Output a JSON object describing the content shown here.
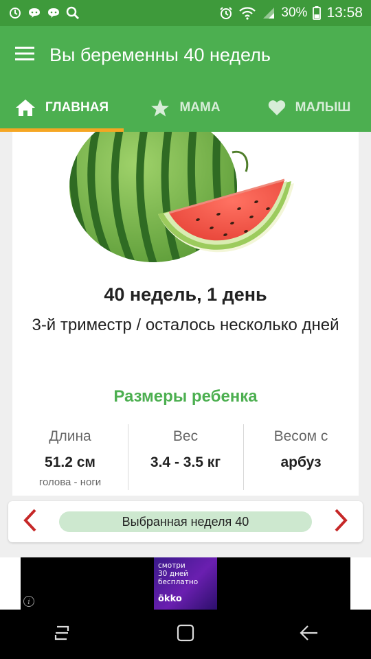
{
  "status_bar": {
    "battery_percent": "30%",
    "time": "13:58",
    "left_icons": [
      "sync-icon",
      "chat-icon",
      "chat-icon",
      "search-icon"
    ],
    "right_icons": [
      "alarm-icon",
      "wifi-icon",
      "signal-icon",
      "battery-icon"
    ]
  },
  "app_bar": {
    "title": "Вы беременны 40 недель"
  },
  "tabs": [
    {
      "label": "ГЛАВНАЯ",
      "icon": "home-icon",
      "active": true
    },
    {
      "label": "МАМА",
      "icon": "star-icon",
      "active": false
    },
    {
      "label": "МАЛЫШ",
      "icon": "heart-icon",
      "active": false
    }
  ],
  "card": {
    "image": "watermelon-image",
    "week_title": "40 недель, 1 день",
    "trimester": "3-й триместр / осталось несколько дней",
    "sizes_title": "Размеры ребенка",
    "metrics": [
      {
        "label": "Длина",
        "value": "51.2 см",
        "sub": "голова - ноги"
      },
      {
        "label": "Вес",
        "value": "3.4 - 3.5 кг",
        "sub": ""
      },
      {
        "label": "Весом с",
        "value": "арбуз",
        "sub": ""
      }
    ]
  },
  "week_selector": {
    "label": "Выбранная неделя 40"
  },
  "ad": {
    "text": "смотри\n30 дней\nбесплатно",
    "brand": "ökko"
  },
  "nav_bar": {
    "buttons": [
      "recents-icon",
      "home-square-icon",
      "back-icon"
    ]
  },
  "colors": {
    "status_bar": "#3e9a3b",
    "app_bar": "#4caf50",
    "tab_indicator": "#f5a623",
    "accent_green": "#4caf50",
    "arrow_red": "#c62828",
    "pill": "#cde8cf"
  }
}
